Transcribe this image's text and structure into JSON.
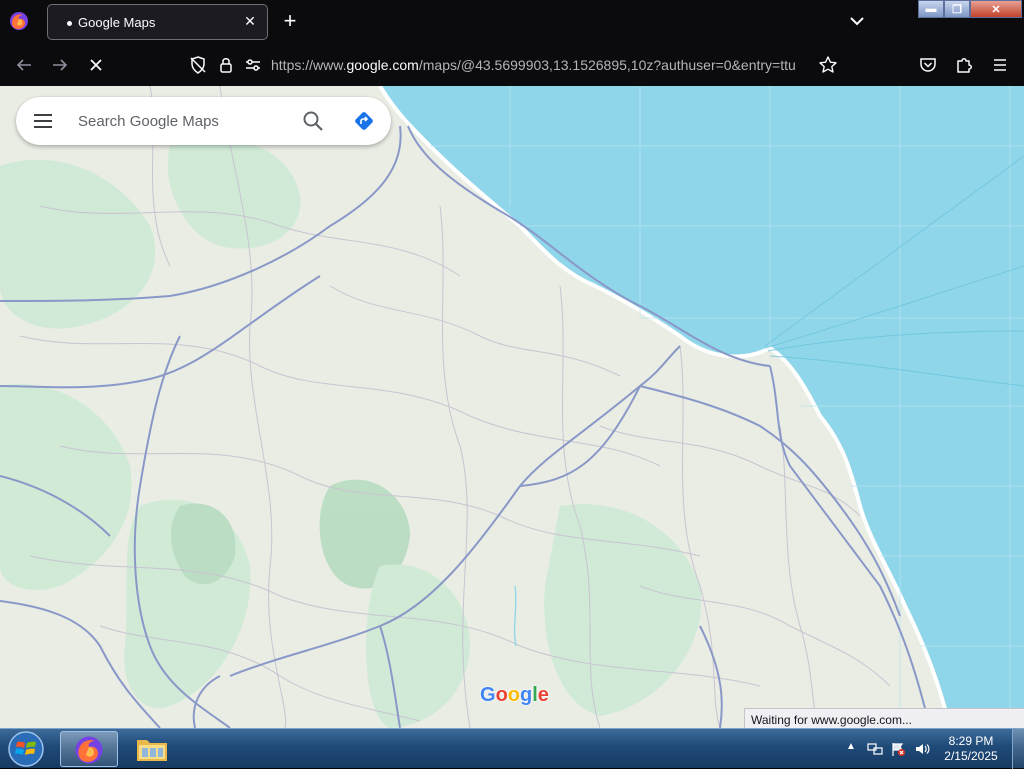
{
  "browser": {
    "tab": {
      "title": "Google Maps",
      "loading_dot": "•",
      "close_glyph": "✕"
    },
    "new_tab_glyph": "+",
    "url": {
      "prefix": "https://www.",
      "domain": "google.com",
      "rest": "/maps/@43.5699903,13.1526895,10z?authuser=0&entry=ttu"
    },
    "window_controls": {
      "minimize": "▬",
      "maximize": "❐",
      "close": "✕"
    },
    "status_text": "Waiting for www.google.com..."
  },
  "maps": {
    "search_placeholder": "Search Google Maps",
    "logo_letters": [
      "G",
      "o",
      "o",
      "g",
      "l",
      "e"
    ],
    "colors": {
      "land": "#e9ede4",
      "green": "#cfead6",
      "water": "#8fd6ea",
      "road": "#8a98c8",
      "coast": "#ffffff",
      "brand_blue": "#4285F4",
      "brand_red": "#EA4335",
      "brand_yellow": "#FBBC05",
      "brand_green": "#34A853"
    }
  },
  "taskbar": {
    "clock_time": "8:29 PM",
    "clock_date": "2/15/2025",
    "tray_arrow": "▲"
  },
  "icons": [
    "firefox-logo-icon",
    "tab-list-chevron-icon",
    "back-arrow-icon",
    "forward-arrow-icon",
    "stop-loading-icon",
    "tracking-protection-icon",
    "lock-icon",
    "permissions-icon",
    "bookmark-star-icon",
    "pocket-icon",
    "extensions-icon",
    "app-menu-icon",
    "hamburger-menu-icon",
    "search-icon",
    "directions-icon",
    "windows-start-icon",
    "firefox-taskbar-icon",
    "file-explorer-icon",
    "network-icon",
    "flag-icon",
    "volume-icon"
  ]
}
